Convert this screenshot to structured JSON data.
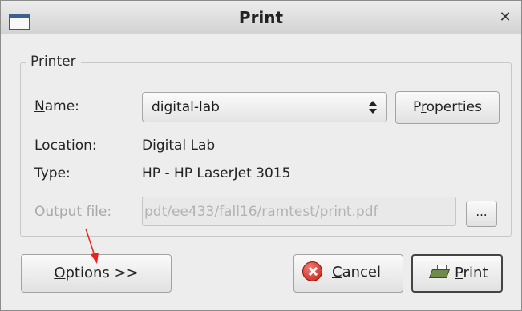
{
  "window": {
    "title": "Print"
  },
  "printer": {
    "section_label": "Printer",
    "name_label": "Name:",
    "name_value": "digital-lab",
    "properties_button": "Properties",
    "location_label": "Location:",
    "location_value": "Digital Lab",
    "type_label": "Type:",
    "type_value": "HP - HP LaserJet 3015",
    "output_file_label": "Output file:",
    "output_file_value": "pdt/ee433/fall16/ramtest/print.pdf",
    "browse_button": "..."
  },
  "buttons": {
    "options": "Options >>",
    "cancel": "Cancel",
    "print": "Print"
  },
  "colors": {
    "annotation_arrow": "#e8231c",
    "cancel_icon": "#d0261b"
  },
  "icons": {
    "window": "window-icon",
    "close": "close-icon",
    "cancel": "cancel-icon",
    "print": "printer-icon",
    "combo": "updown-arrows-icon"
  }
}
